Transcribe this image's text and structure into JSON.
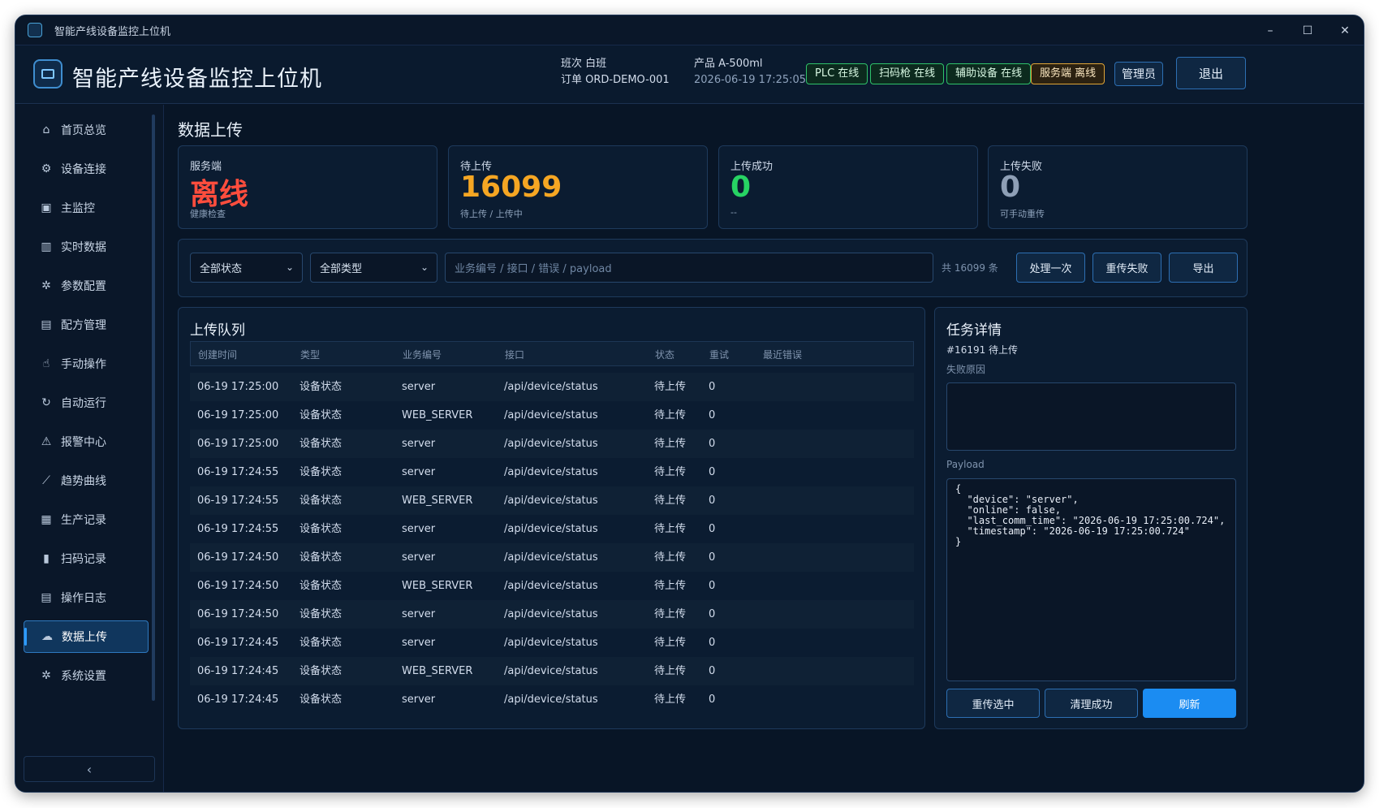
{
  "window": {
    "title": "智能产线设备监控上位机"
  },
  "header": {
    "app_title": "智能产线设备监控上位机",
    "shift": "班次 白班",
    "order": "订单 ORD-DEMO-001",
    "product": "产品 A-500ml",
    "datetime": "2026-06-19 17:25:05",
    "status_pills": [
      {
        "label": "PLC 在线",
        "state": "ok"
      },
      {
        "label": "扫码枪 在线",
        "state": "ok"
      },
      {
        "label": "辅助设备 在线",
        "state": "ok"
      },
      {
        "label": "服务端 离线",
        "state": "bad"
      }
    ],
    "user_label": "管理员",
    "logout_label": "退出"
  },
  "sidebar": {
    "items": [
      {
        "label": "首页总览",
        "icon": "home-icon"
      },
      {
        "label": "设备连接",
        "icon": "device-connect-icon"
      },
      {
        "label": "主监控",
        "icon": "monitor-icon"
      },
      {
        "label": "实时数据",
        "icon": "bar-chart-icon"
      },
      {
        "label": "参数配置",
        "icon": "gear-icon"
      },
      {
        "label": "配方管理",
        "icon": "recipe-icon"
      },
      {
        "label": "手动操作",
        "icon": "hand-icon"
      },
      {
        "label": "自动运行",
        "icon": "refresh-icon"
      },
      {
        "label": "报警中心",
        "icon": "warning-icon"
      },
      {
        "label": "趋势曲线",
        "icon": "line-chart-icon"
      },
      {
        "label": "生产记录",
        "icon": "record-icon"
      },
      {
        "label": "扫码记录",
        "icon": "barcode-icon"
      },
      {
        "label": "操作日志",
        "icon": "log-icon"
      },
      {
        "label": "数据上传",
        "icon": "upload-icon",
        "active": true
      },
      {
        "label": "系统设置",
        "icon": "settings-icon"
      }
    ],
    "collapse_glyph": "‹"
  },
  "page": {
    "title": "数据上传",
    "cards": [
      {
        "label": "服务端",
        "value": "离线",
        "sub": "健康检查",
        "color": "#ff4d3d"
      },
      {
        "label": "待上传",
        "value": "16099",
        "sub": "待上传 / 上传中",
        "color": "#f5a623"
      },
      {
        "label": "上传成功",
        "value": "0",
        "sub": "--",
        "color": "#27d363"
      },
      {
        "label": "上传失败",
        "value": "0",
        "sub": "可手动重传",
        "color": "#8e9fb6"
      }
    ],
    "filter": {
      "status_select": "全部状态",
      "type_select": "全部类型",
      "search_placeholder": "业务编号 / 接口 / 错误 / payload",
      "count_text": "共 16099 条",
      "process_once": "处理一次",
      "retry_failed": "重传失败",
      "export": "导出"
    },
    "queue": {
      "title": "上传队列",
      "columns": [
        "创建时间",
        "类型",
        "业务编号",
        "接口",
        "状态",
        "重试",
        "最近错误"
      ],
      "rows": [
        [
          "06-19 17:25:00",
          "设备状态",
          "server",
          "/api/device/status",
          "待上传",
          "0",
          ""
        ],
        [
          "06-19 17:25:00",
          "设备状态",
          "WEB_SERVER",
          "/api/device/status",
          "待上传",
          "0",
          ""
        ],
        [
          "06-19 17:25:00",
          "设备状态",
          "server",
          "/api/device/status",
          "待上传",
          "0",
          ""
        ],
        [
          "06-19 17:24:55",
          "设备状态",
          "server",
          "/api/device/status",
          "待上传",
          "0",
          ""
        ],
        [
          "06-19 17:24:55",
          "设备状态",
          "WEB_SERVER",
          "/api/device/status",
          "待上传",
          "0",
          ""
        ],
        [
          "06-19 17:24:55",
          "设备状态",
          "server",
          "/api/device/status",
          "待上传",
          "0",
          ""
        ],
        [
          "06-19 17:24:50",
          "设备状态",
          "server",
          "/api/device/status",
          "待上传",
          "0",
          ""
        ],
        [
          "06-19 17:24:50",
          "设备状态",
          "WEB_SERVER",
          "/api/device/status",
          "待上传",
          "0",
          ""
        ],
        [
          "06-19 17:24:50",
          "设备状态",
          "server",
          "/api/device/status",
          "待上传",
          "0",
          ""
        ],
        [
          "06-19 17:24:45",
          "设备状态",
          "server",
          "/api/device/status",
          "待上传",
          "0",
          ""
        ],
        [
          "06-19 17:24:45",
          "设备状态",
          "WEB_SERVER",
          "/api/device/status",
          "待上传",
          "0",
          ""
        ],
        [
          "06-19 17:24:45",
          "设备状态",
          "server",
          "/api/device/status",
          "待上传",
          "0",
          ""
        ]
      ]
    },
    "detail": {
      "title": "任务详情",
      "task_id": "#16191 待上传",
      "reason_label": "失败原因",
      "reason_value": "",
      "payload_label": "Payload",
      "payload": "{\n  \"device\": \"server\",\n  \"online\": false,\n  \"last_comm_time\": \"2026-06-19 17:25:00.724\",\n  \"timestamp\": \"2026-06-19 17:25:00.724\"\n}",
      "retry_selected": "重传选中",
      "clear_success": "清理成功",
      "refresh": "刷新"
    }
  }
}
